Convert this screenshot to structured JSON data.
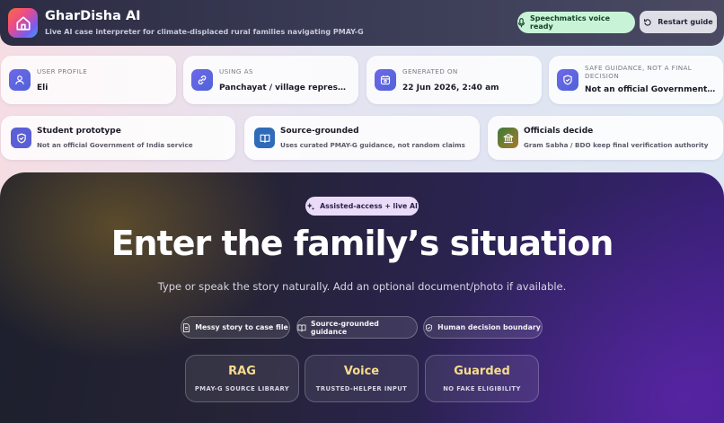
{
  "header": {
    "title": "GharDisha AI",
    "subtitle": "Live AI case interpreter for climate-displaced rural families navigating PMAY-G",
    "voice_status": "Speechmatics voice ready",
    "restart_label": "Restart guide",
    "icons": {
      "logo": "home-icon",
      "voice": "microphone-icon",
      "restart": "restart-icon"
    }
  },
  "info_cards": [
    {
      "label": "USER PROFILE",
      "value": "Eli",
      "icon": "user-icon"
    },
    {
      "label": "USING AS",
      "value": "Panchayat / village representative",
      "icon": "link-icon"
    },
    {
      "label": "GENERATED ON",
      "value": "22 Jun 2026, 2:40 am",
      "icon": "calendar-icon"
    },
    {
      "label": "SAFE GUIDANCE, NOT A FINAL DECISION",
      "value": "Not an official Government of India service",
      "icon": "shield-icon"
    }
  ],
  "notice_cards": [
    {
      "title": "Student prototype",
      "description": "Not an official Government of India service",
      "icon": "shield-check-icon",
      "icon_color": "#5b5fd6"
    },
    {
      "title": "Source-grounded",
      "description": "Uses curated PMAY-G guidance, not random claims",
      "icon": "book-icon",
      "icon_color": "#2f6bb8"
    },
    {
      "title": "Officials decide",
      "description": "Gram Sabha / BDO keep final verification authority",
      "icon": "institution-icon",
      "icon_color": "#4c7a3a"
    }
  ],
  "hero": {
    "badge": "Assisted-access + live AI",
    "badge_icon": "sparkle-icon",
    "title": "Enter the family’s situation",
    "subtitle": "Type or speak the story naturally. Add an optional document/photo if available.",
    "features": [
      {
        "label": "Messy story to case file",
        "icon": "document-icon"
      },
      {
        "label": "Source-grounded guidance",
        "icon": "open-book-icon"
      },
      {
        "label": "Human decision boundary",
        "icon": "shield-icon"
      }
    ],
    "stats": [
      {
        "title": "RAG",
        "caption": "PMAY-G SOURCE LIBRARY"
      },
      {
        "title": "Voice",
        "caption": "TRUSTED-HELPER INPUT"
      },
      {
        "title": "Guarded",
        "caption": "NO FAKE ELIGIBILITY"
      }
    ]
  },
  "colors": {
    "header_bg": "#2c2d44",
    "voice_pill_bg": "#c9f3d7",
    "accent_gold": "#f6dc8c",
    "accent_purple": "#6e68e8"
  }
}
